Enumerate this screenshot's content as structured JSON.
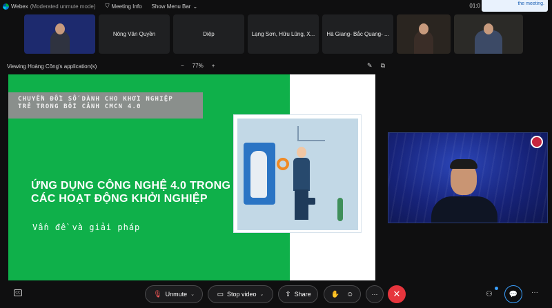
{
  "topbar": {
    "app_name": "Webex",
    "status": "(Moderated unmute mode)",
    "meeting_info": "Meeting Info",
    "show_menu_bar": "Show Menu Bar",
    "clock": "01:0",
    "notice": "the meeting."
  },
  "participants": [
    {
      "name": "",
      "kind": "video"
    },
    {
      "name": "Nông Văn Quyền"
    },
    {
      "name": "Diệp"
    },
    {
      "name": "Lạng Sơn, Hữu Lũng, X..."
    },
    {
      "name": "Hà Giang- Bắc Quang- ..."
    },
    {
      "name": "",
      "kind": "photo"
    },
    {
      "name": "",
      "kind": "photo"
    }
  ],
  "viewbar": {
    "title": "Viewing Hoàng Công's application(s)",
    "zoom_minus": "−",
    "zoom_level": "77%",
    "zoom_plus": "+"
  },
  "slide": {
    "banner_line1": "CHUYỂN ĐỔI SỐ DÀNH CHO KHỞI NGHIỆP",
    "banner_line2": "TRẺ TRONG BỐI CẢNH CMCN 4.0",
    "headline": "ỨNG DỤNG CÔNG NGHỆ 4.0 TRONG CÁC HOẠT ĐỘNG KHỞI NGHIỆP",
    "subline": "Vấn đề và giải pháp"
  },
  "controls": {
    "unmute": "Unmute",
    "stop_video": "Stop video",
    "share": "Share",
    "end": "✕",
    "more": "···"
  },
  "colors": {
    "slide_green": "#0fb04a",
    "end_red": "#e6353d",
    "speaker_bg": "#17237a"
  }
}
